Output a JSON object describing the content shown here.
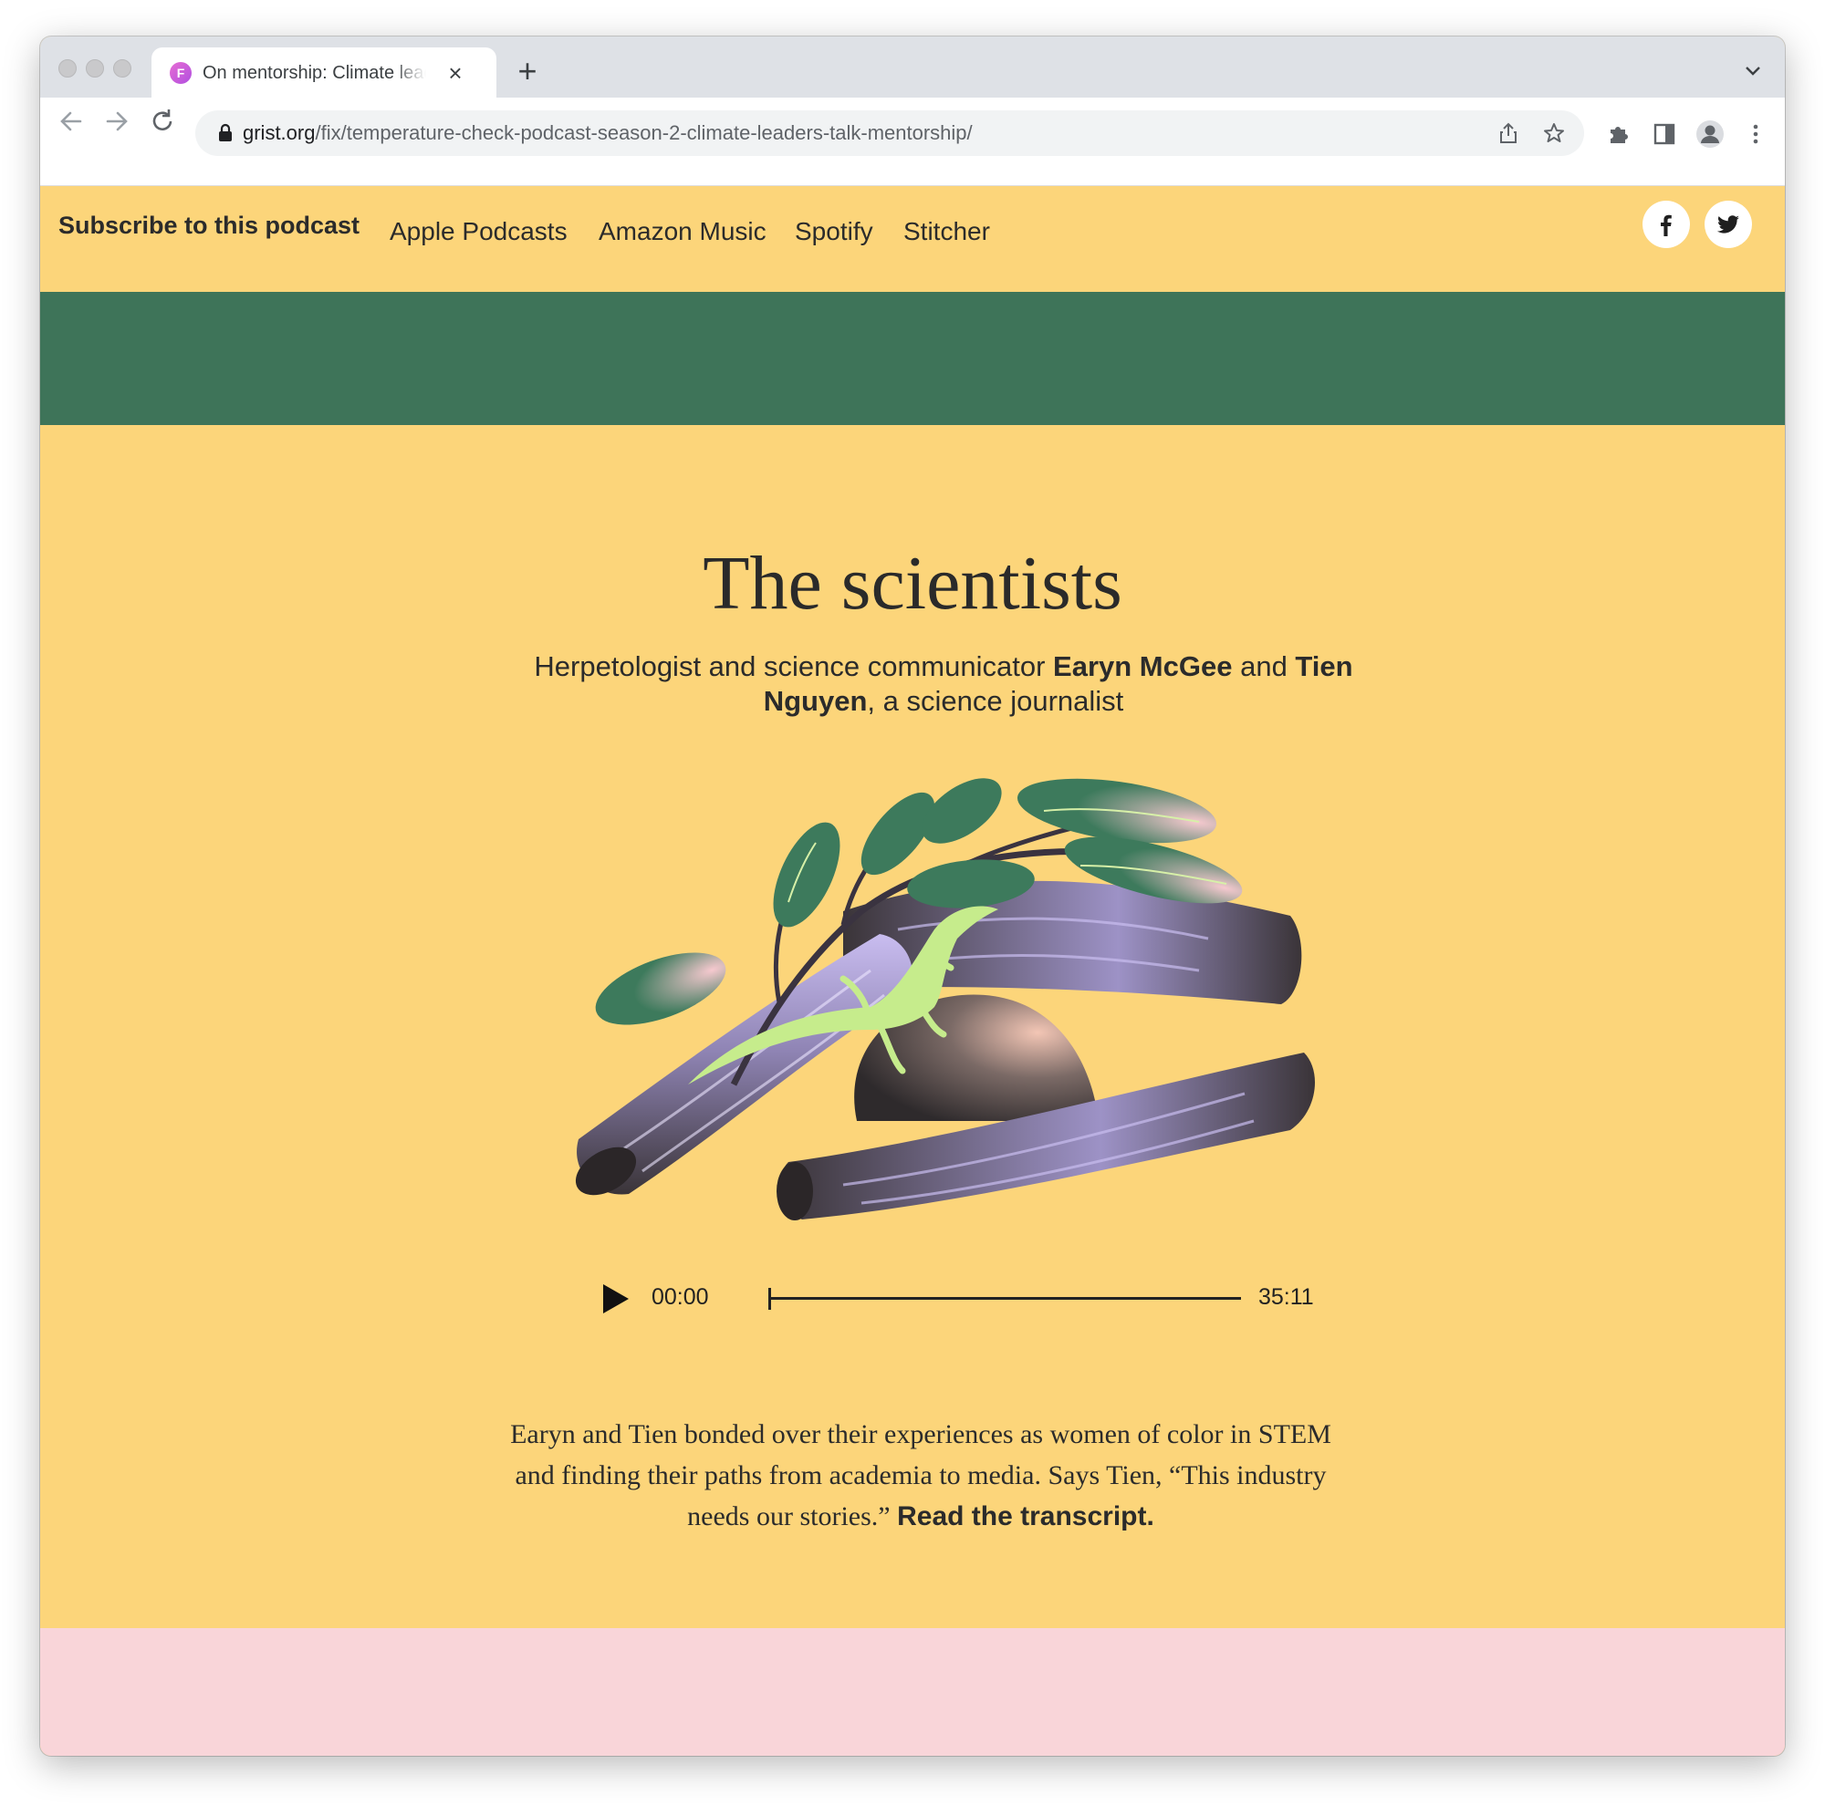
{
  "browser": {
    "tab_title": "On mentorship: Climate leaders talk mentorship",
    "tab_favicon_letter": "F",
    "url_host": "grist.org",
    "url_path": "/fix/temperature-check-podcast-season-2-climate-leaders-talk-mentorship/"
  },
  "subscribe": {
    "label": "Subscribe to this podcast",
    "links": [
      "Apple Podcasts",
      "Amazon Music",
      "Spotify",
      "Stitcher"
    ]
  },
  "social": [
    "facebook-icon",
    "twitter-icon"
  ],
  "section": {
    "title": "The scientists",
    "subtitle_pre": "Herpetologist and science communicator ",
    "name1": "Earyn McGee",
    "subtitle_mid": " and ",
    "name2": "Tien Nguyen",
    "subtitle_post": ", a science journalist"
  },
  "player": {
    "current_time": "00:00",
    "duration": "35:11",
    "progress": 0
  },
  "description": {
    "text": "Earyn and Tien bonded over their experiences as women of color in STEM and finding their paths from academia to media. Says Tien, “This industry needs our stories.” ",
    "link": "Read the transcript."
  },
  "colors": {
    "page_bg": "#fcd57a",
    "green_band": "#3e7459",
    "pink_band": "#f9d5d9"
  }
}
